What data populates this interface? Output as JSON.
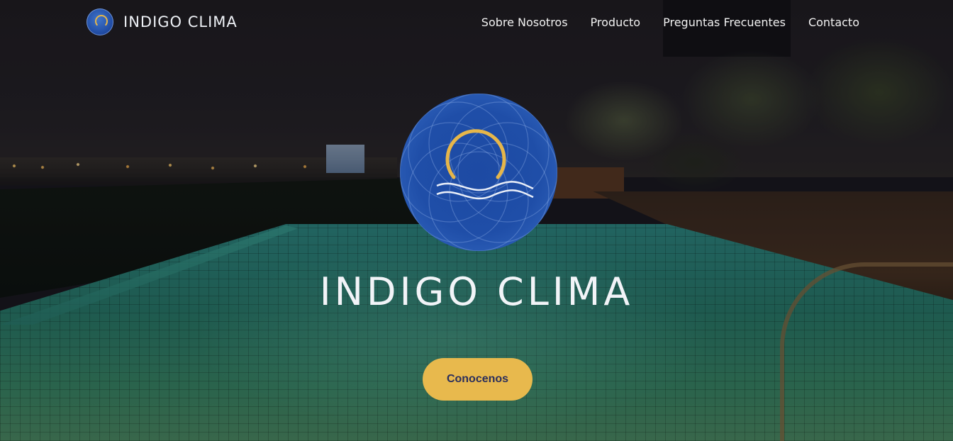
{
  "header": {
    "brand_name": "INDIGO CLIMA",
    "logo_icon": "indigo-clima-logo-icon",
    "nav": [
      {
        "label": "Sobre Nosotros"
      },
      {
        "label": "Producto"
      },
      {
        "label": "Preguntas Frecuentes"
      },
      {
        "label": "Contacto"
      }
    ]
  },
  "hero": {
    "title": "INDIGO CLIMA",
    "logo_icon": "sun-over-waves-logo-icon",
    "cta_label": "Conocenos",
    "background": "night-rooftop-pool-photo"
  },
  "colors": {
    "accent": "#e8b94d",
    "cta_text": "#2b2f5c",
    "logo_blue": "#1f4ea8",
    "logo_gold": "#e6b64a",
    "text_light": "#f2f4f8"
  }
}
